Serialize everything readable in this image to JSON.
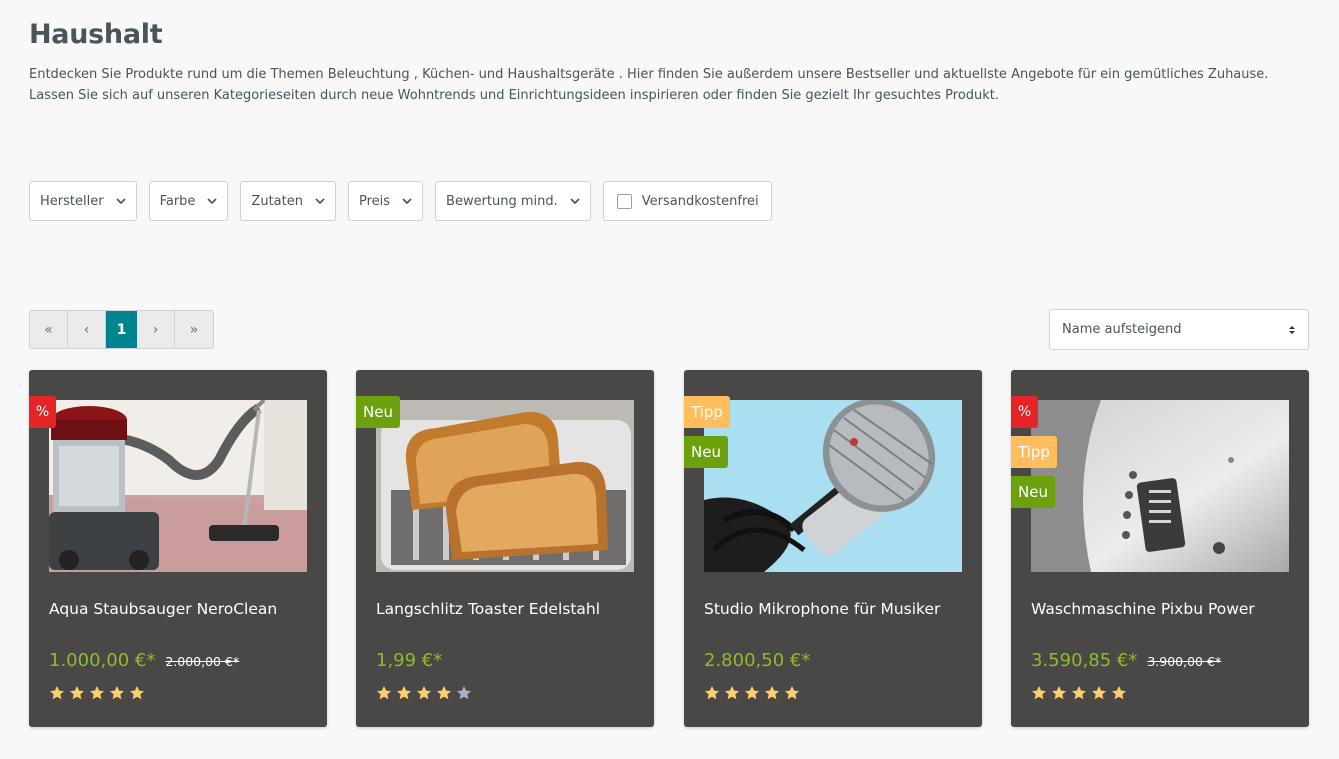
{
  "page": {
    "title": "Haushalt",
    "description_line1": "Entdecken Sie Produkte rund um die Themen Beleuchtung , Küchen- und Haushaltsgeräte . Hier finden Sie außerdem unsere Bestseller und aktuellste Angebote für ein gemütliches Zuhause.",
    "description_line2": "Lassen Sie sich auf unseren Kategorieseiten durch neue Wohntrends und Einrichtungsideen inspirieren oder finden Sie gezielt Ihr gesuchtes Produkt."
  },
  "filters": {
    "manufacturer": "Hersteller",
    "color": "Farbe",
    "ingredients": "Zutaten",
    "price": "Preis",
    "rating": "Bewertung mind.",
    "free_shipping": "Versandkostenfrei",
    "free_shipping_checked": false
  },
  "pagination": {
    "first": "«",
    "prev": "‹",
    "current": "1",
    "next": "›",
    "last": "»"
  },
  "sort": {
    "selected": "Name aufsteigend"
  },
  "colors": {
    "accent": "#008490",
    "card_bg": "#4a4847",
    "price_green": "#90bb2a",
    "badge_sale": "#e52427",
    "badge_new": "#6da00d",
    "badge_tip": "#ffbd5d",
    "star_filled": "#ffd06a",
    "star_empty": "#a8b4c2"
  },
  "products": [
    {
      "name": "Aqua Staubsauger NeroClean",
      "price": "1.000,00 €*",
      "old_price": "2.000,00 €*",
      "badges": [
        "%"
      ],
      "rating": 5,
      "image": "vacuum-cleaner"
    },
    {
      "name": "Langschlitz Toaster Edelstahl",
      "price": "1,99 €*",
      "old_price": "",
      "badges": [
        "Neu"
      ],
      "rating": 4,
      "image": "toaster"
    },
    {
      "name": "Studio Mikrophone für Musiker",
      "price": "2.800,50 €*",
      "old_price": "",
      "badges": [
        "Tipp",
        "Neu"
      ],
      "rating": 5,
      "image": "microphone"
    },
    {
      "name": "Waschmaschine Pixbu Power",
      "price": "3.590,85 €*",
      "old_price": "3.900,00 €*",
      "badges": [
        "%",
        "Tipp",
        "Neu"
      ],
      "rating": 5,
      "image": "washing-machine"
    }
  ]
}
